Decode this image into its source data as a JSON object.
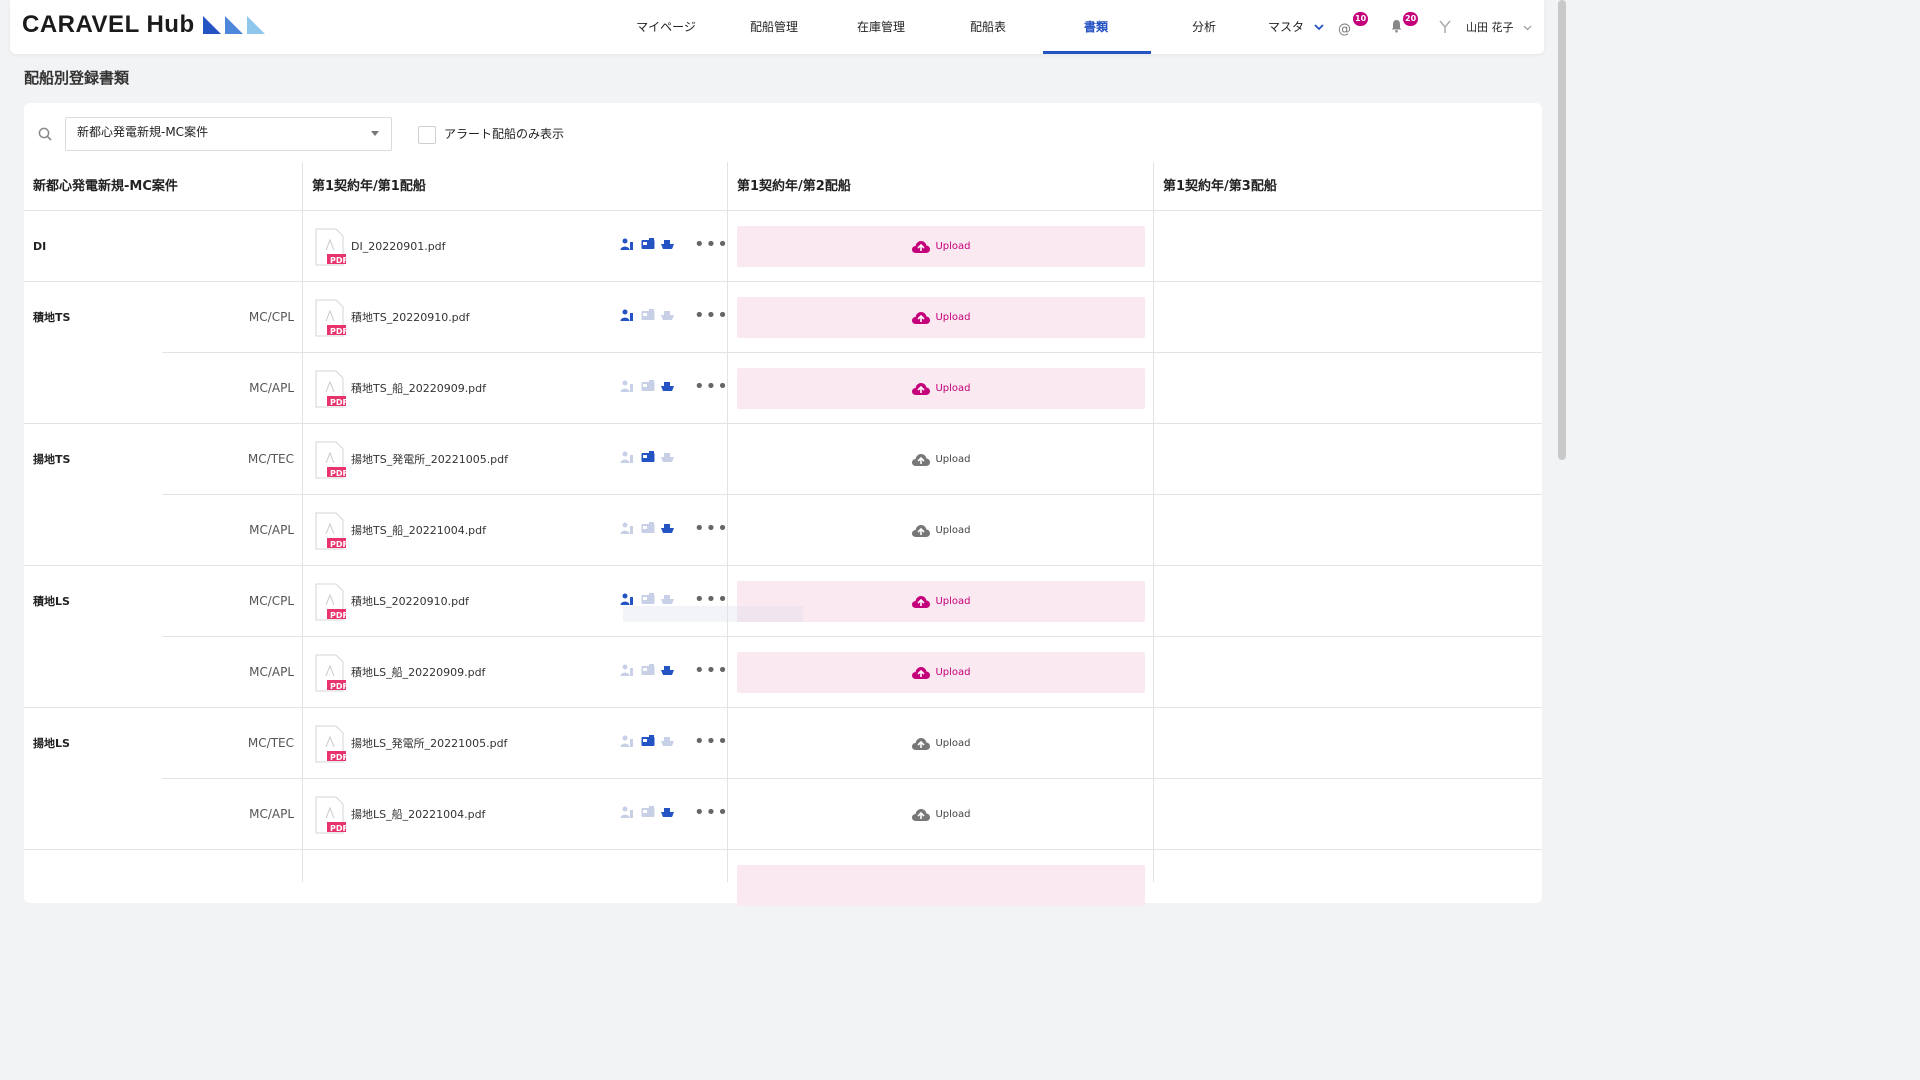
{
  "header": {
    "logo": "CARAVEL Hub",
    "nav": [
      {
        "label": "マイページ",
        "active": false
      },
      {
        "label": "配船管理",
        "active": false
      },
      {
        "label": "在庫管理",
        "active": false
      },
      {
        "label": "配船表",
        "active": false
      },
      {
        "label": "書類",
        "active": true
      },
      {
        "label": "分析",
        "active": false
      },
      {
        "label": "マスタ",
        "active": false
      }
    ],
    "mentions_count": "10",
    "notifications_count": "20",
    "user_name": "山田 花子"
  },
  "page_title": "配船別登録書類",
  "filter": {
    "project_select": "新都心発電新規-MC案件",
    "alert_only_label": "アラート配船のみ表示"
  },
  "table": {
    "headers": [
      "新都心発電新規-MC案件",
      "第1契約年/第1配船",
      "第1契約年/第2配船",
      "第1契約年/第3配船"
    ],
    "rows": [
      {
        "category": "DI",
        "sub": "",
        "file": "DI_20220901.pdf",
        "upload": "Upload",
        "alert": true
      },
      {
        "category": "積地TS",
        "sub": "MC/CPL",
        "file": "積地TS_20220910.pdf",
        "upload": "Upload",
        "alert": true
      },
      {
        "category": "",
        "sub": "MC/APL",
        "file": "積地TS_船_20220909.pdf",
        "upload": "Upload",
        "alert": true
      },
      {
        "category": "揚地TS",
        "sub": "MC/TEC",
        "file": "揚地TS_発電所_20221005.pdf",
        "upload": "Upload",
        "alert": false
      },
      {
        "category": "",
        "sub": "MC/APL",
        "file": "揚地TS_船_20221004.pdf",
        "upload": "Upload",
        "alert": false
      },
      {
        "category": "積地LS",
        "sub": "MC/CPL",
        "file": "積地LS_20220910.pdf",
        "upload": "Upload",
        "alert": true
      },
      {
        "category": "",
        "sub": "MC/APL",
        "file": "積地LS_船_20220909.pdf",
        "upload": "Upload",
        "alert": true
      },
      {
        "category": "揚地LS",
        "sub": "MC/TEC",
        "file": "揚地LS_発電所_20221005.pdf",
        "upload": "Upload",
        "alert": false
      },
      {
        "category": "",
        "sub": "MC/APL",
        "file": "揚地LS_船_20221004.pdf",
        "upload": "Upload",
        "alert": false
      }
    ],
    "file_badge": "PDF"
  },
  "colors": {
    "accent": "#2453c3",
    "alert": "#c4007a",
    "alert_bg": "#fbe9f2",
    "pdf": "#e8336d"
  }
}
